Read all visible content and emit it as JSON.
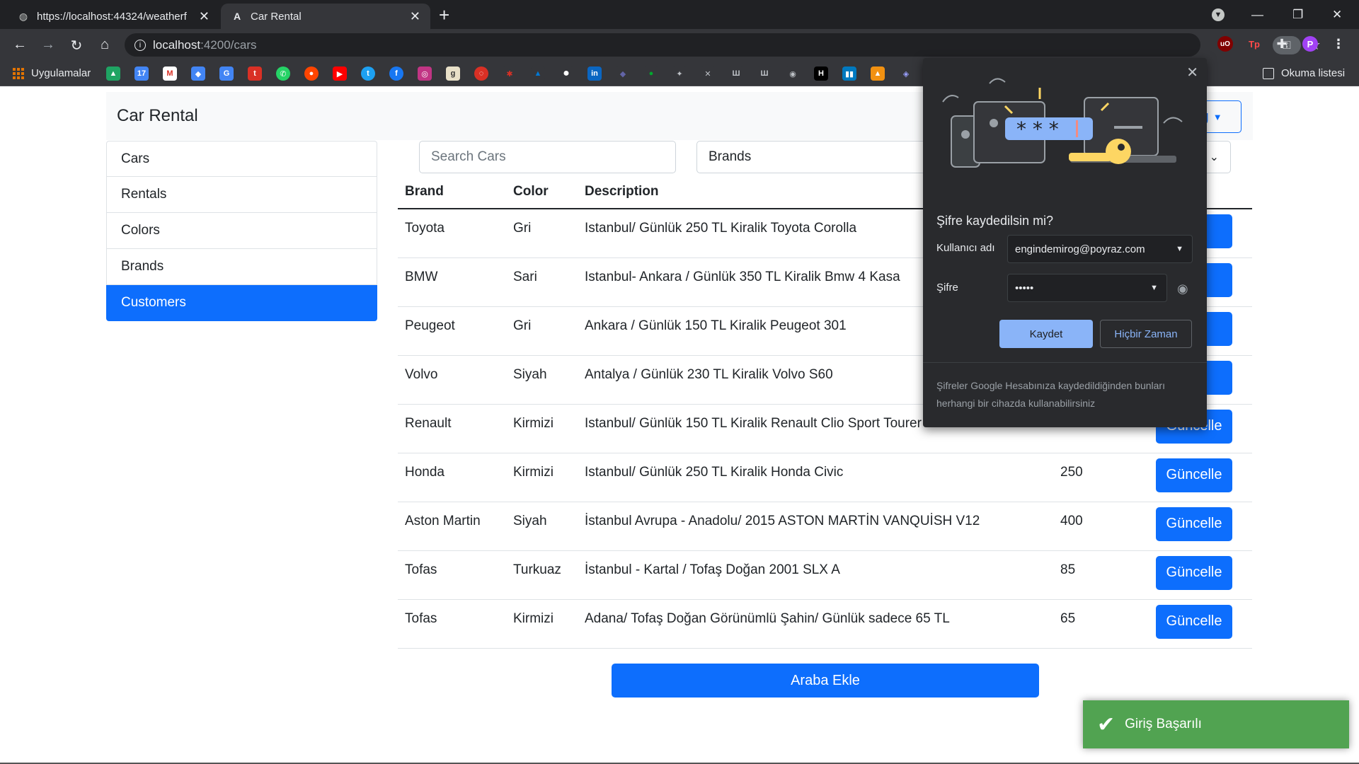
{
  "browser": {
    "tabs": [
      {
        "title": "https://localhost:44324/weatherf",
        "active": false,
        "icon": "globe-icon"
      },
      {
        "title": "Car Rental",
        "active": true,
        "icon": "angular-icon"
      }
    ],
    "url_host": "localhost",
    "url_path": ":4200/cars",
    "bookmarks_apps_label": "Uygulamalar",
    "reading_list_label": "Okuma listesi",
    "profile_initial": "P"
  },
  "app": {
    "title": "Car Rental",
    "dropdown_label": "og",
    "sidebar": [
      {
        "label": "Cars",
        "active": false
      },
      {
        "label": "Rentals",
        "active": false
      },
      {
        "label": "Colors",
        "active": false
      },
      {
        "label": "Brands",
        "active": false
      },
      {
        "label": "Customers",
        "active": true
      }
    ],
    "search_placeholder": "Search Cars",
    "brand_select": "Brands",
    "table": {
      "headers": [
        "Brand",
        "Color",
        "Description",
        "",
        ""
      ],
      "rows": [
        {
          "brand": "Toyota",
          "color": "Gri",
          "description": "Istanbul/ Günlük 250 TL Kiralik Toyota Corolla",
          "price": "",
          "action": "lle"
        },
        {
          "brand": "BMW",
          "color": "Sari",
          "description": "Istanbul- Ankara / Günlük 350 TL Kiralik Bmw 4 Kasa",
          "price": "",
          "action": "lle"
        },
        {
          "brand": "Peugeot",
          "color": "Gri",
          "description": "Ankara / Günlük 150 TL Kiralik Peugeot 301",
          "price": "",
          "action": "lle"
        },
        {
          "brand": "Volvo",
          "color": "Siyah",
          "description": "Antalya / Günlük 230 TL Kiralik Volvo S60",
          "price": "",
          "action": "lle"
        },
        {
          "brand": "Renault",
          "color": "Kirmizi",
          "description": "Istanbul/ Günlük 150 TL Kiralik Renault Clio Sport Tourer Station",
          "price": "150",
          "action": "Güncelle"
        },
        {
          "brand": "Honda",
          "color": "Kirmizi",
          "description": "Istanbul/ Günlük 250 TL Kiralik Honda Civic",
          "price": "250",
          "action": "Güncelle"
        },
        {
          "brand": "Aston Martin",
          "color": "Siyah",
          "description": "İstanbul Avrupa - Anadolu/ 2015 ASTON MARTİN VANQUİSH V12",
          "price": "400",
          "action": "Güncelle"
        },
        {
          "brand": "Tofas",
          "color": "Turkuaz",
          "description": "İstanbul - Kartal / Tofaş Doğan 2001 SLX A",
          "price": "85",
          "action": "Güncelle"
        },
        {
          "brand": "Tofas",
          "color": "Kirmizi",
          "description": "Adana/ Tofaş Doğan Görünümlü Şahin/ Günlük sadece 65 TL",
          "price": "65",
          "action": "Güncelle"
        }
      ]
    },
    "add_button": "Araba Ekle",
    "toast": "Giriş Başarılı"
  },
  "password_popup": {
    "title": "Şifre kaydedilsin mi?",
    "username_label": "Kullanıcı adı",
    "username_value": "engindemirog@poyraz.com",
    "password_label": "Şifre",
    "password_value": "•••••",
    "save_label": "Kaydet",
    "never_label": "Hiçbir Zaman",
    "footer": "Şifreler Google Hesabınıza kaydedildiğinden bunları herhangi bir cihazda kullanabilirsiniz"
  },
  "colors": {
    "primary": "#0d6efd",
    "toast": "#51a351",
    "chrome_dark": "#202124",
    "popup_accent": "#8ab4f8"
  }
}
